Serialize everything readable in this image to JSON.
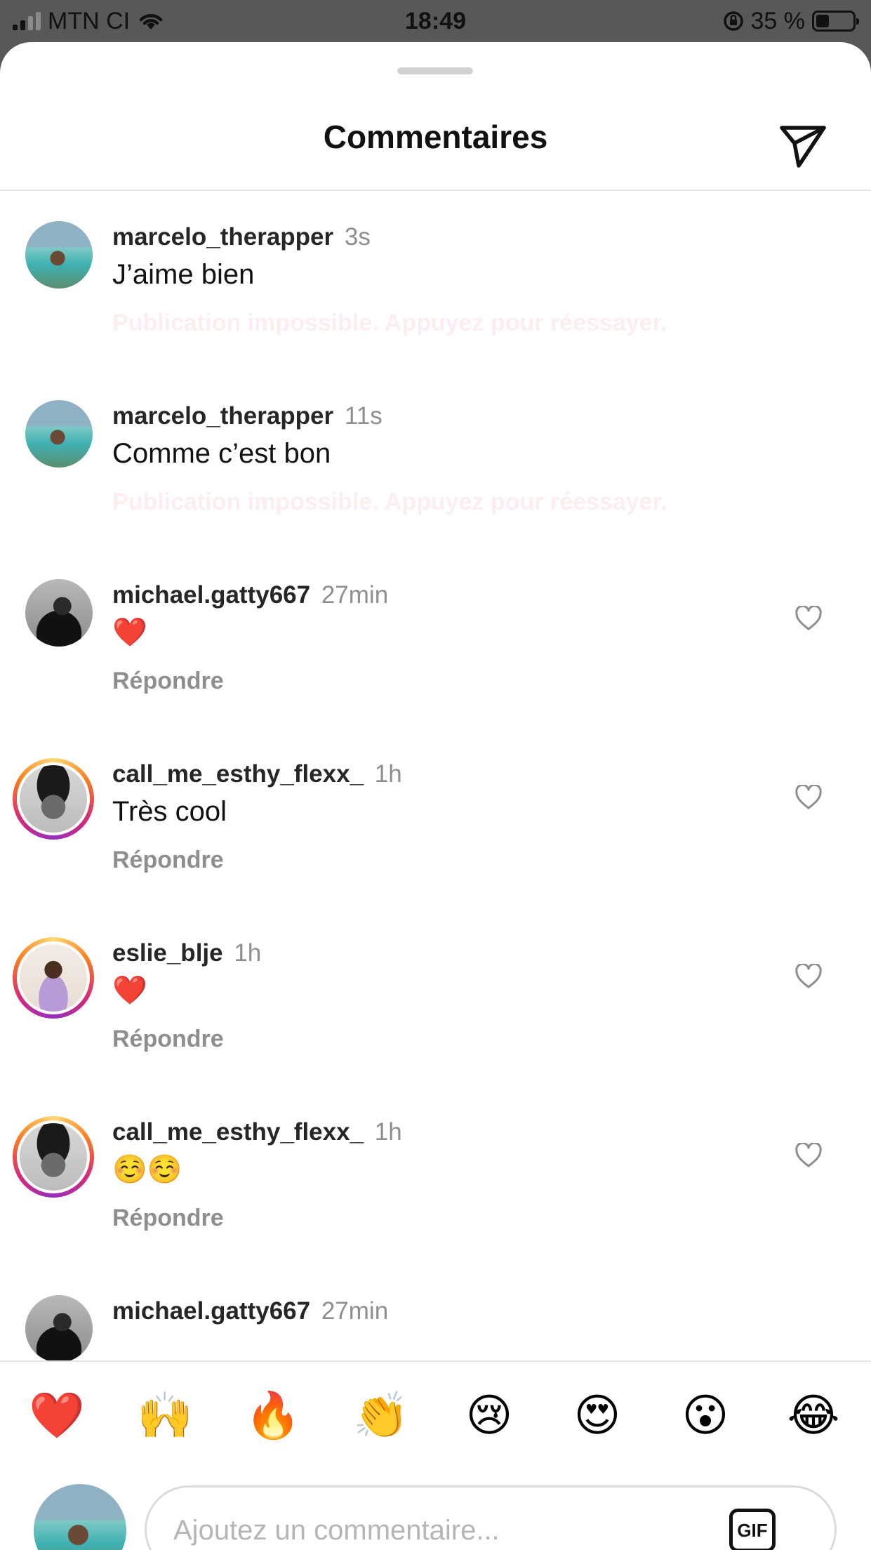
{
  "status_bar": {
    "carrier": "MTN CI",
    "time": "18:49",
    "battery": "35 %",
    "battery_level": 0.35
  },
  "header": {
    "title": "Commentaires",
    "send_icon": "paper-plane-icon"
  },
  "comments": [
    {
      "username": "marcelo_therapper",
      "time": "3s",
      "text": "J’aime bien",
      "footer": "Publication impossible. Appuyez pour réessayer.",
      "failed": true
    },
    {
      "username": "marcelo_therapper",
      "time": "11s",
      "text": "Comme c’est bon",
      "footer": "Publication impossible. Appuyez pour réessayer.",
      "failed": true
    },
    {
      "username": "michael.gatty667",
      "time": "27min",
      "text": "❤️",
      "footer": "Répondre",
      "failed": false
    },
    {
      "username": "call_me_esthy_flexx_",
      "time": "1h",
      "text": "Très cool",
      "footer": "Répondre",
      "failed": false
    },
    {
      "username": "eslie_blje",
      "time": "1h",
      "text": "❤️",
      "footer": "Répondre",
      "failed": false
    },
    {
      "username": "call_me_esthy_flexx_",
      "time": "1h",
      "text": "☺️☺️",
      "footer": "Répondre",
      "failed": false
    },
    {
      "username": "michael.gatty667",
      "time": "27min",
      "text": "",
      "footer": "",
      "failed": false
    }
  ],
  "reactions": [
    "❤️",
    "🙌",
    "🔥",
    "👏",
    "😢",
    "😍",
    "😮",
    "😂"
  ],
  "composer": {
    "placeholder": "Ajoutez un commentaire...",
    "gif_label": "GIF"
  },
  "colors": {
    "failed_text": "#ed4956",
    "secondary_text": "#8e8e8e",
    "primary_text": "#262626"
  }
}
